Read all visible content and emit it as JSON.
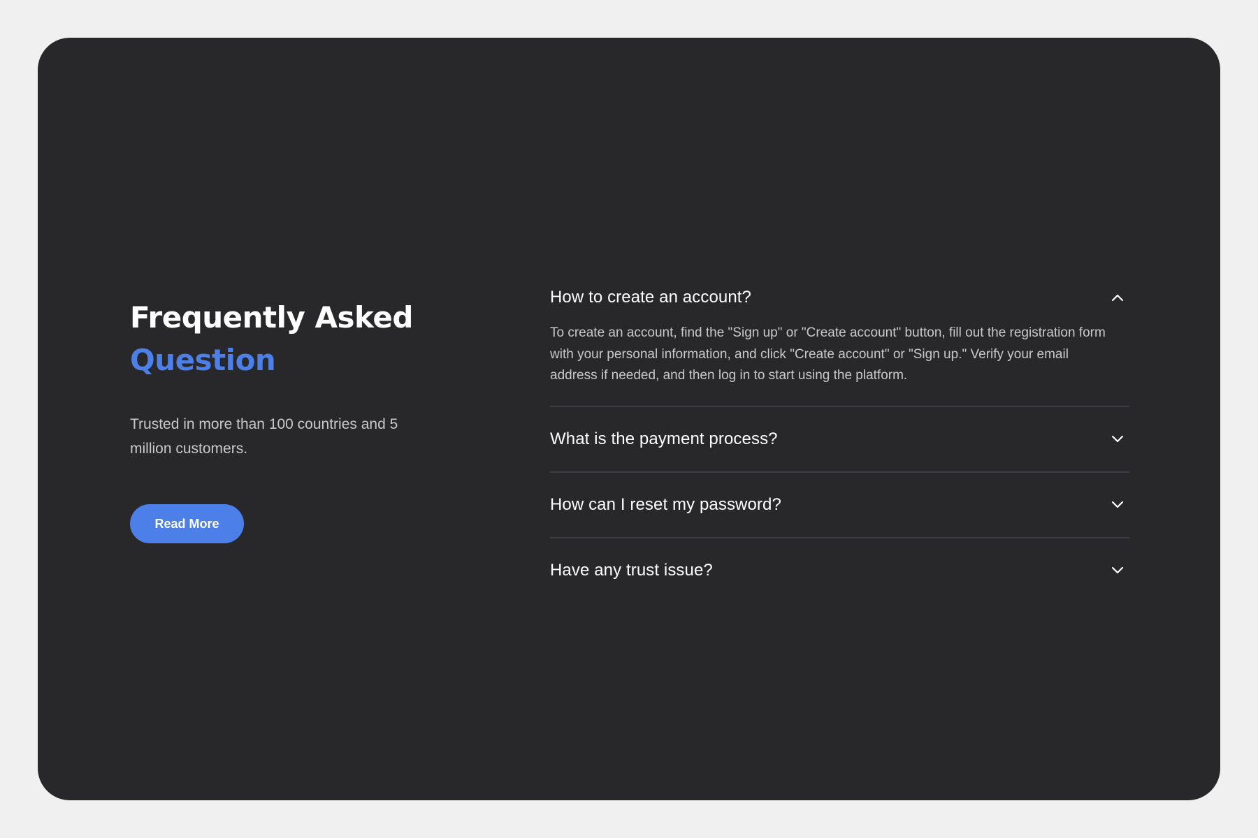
{
  "heading": {
    "line1": "Frequently Asked",
    "line2": "Question"
  },
  "subtitle": "Trusted in more than 100 countries and 5 million customers.",
  "read_more_label": "Read More",
  "faq": [
    {
      "question": "How to create an account?",
      "answer": "To create an account, find the \"Sign up\" or \"Create account\" button, fill out the registration form with your personal information, and click \"Create account\" or \"Sign up.\" Verify your email address if needed, and then log in to start using the platform.",
      "expanded": true,
      "icon": "chevron-up-icon"
    },
    {
      "question": "What is the payment process?",
      "expanded": false,
      "icon": "chevron-down-icon"
    },
    {
      "question": "How can I reset my password?",
      "expanded": false,
      "icon": "chevron-down-icon"
    },
    {
      "question": "Have any trust issue?",
      "expanded": false,
      "icon": "chevron-down-icon"
    }
  ],
  "colors": {
    "page_background": "#f0f0f0",
    "card_background": "#28282a",
    "accent": "#4c7fe8",
    "text_primary": "#ffffff",
    "text_secondary": "#c9c9cc",
    "divider": "#3e3e42"
  }
}
